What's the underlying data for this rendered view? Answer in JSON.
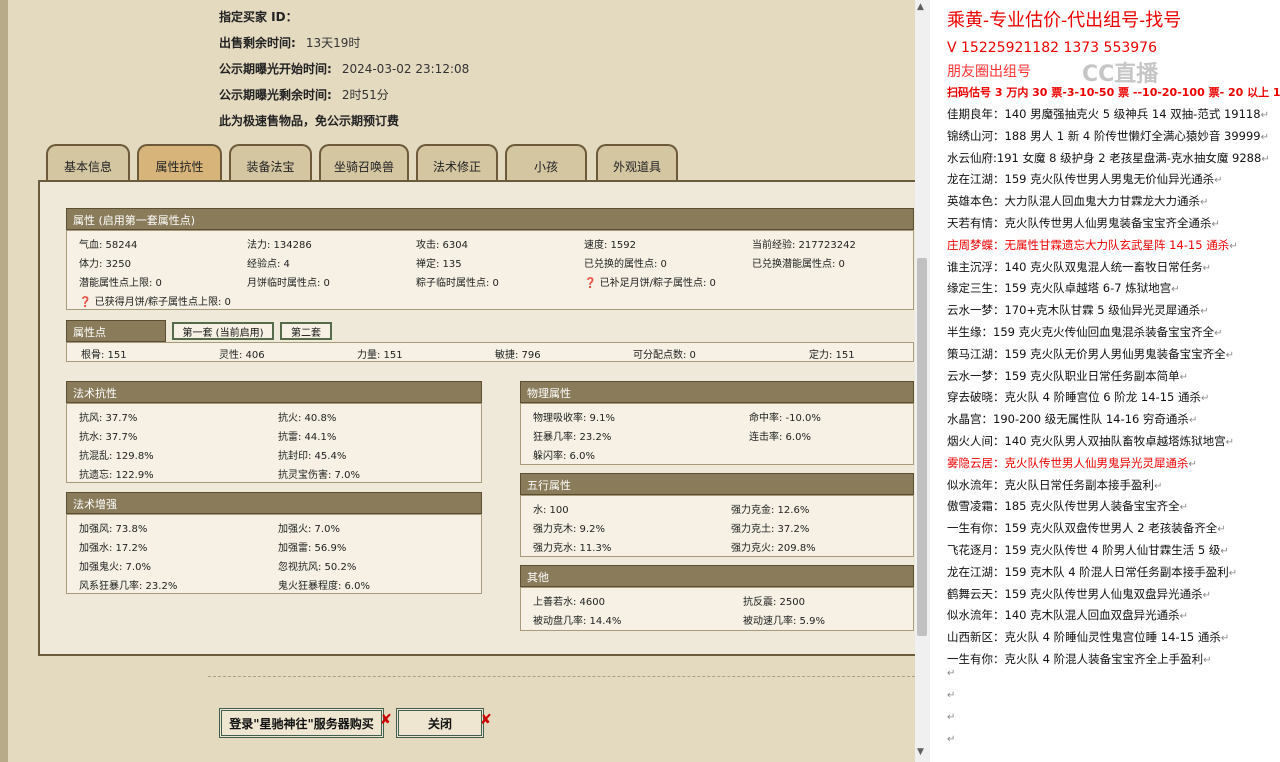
{
  "header_info": {
    "buyer_label": "指定买家 ID：",
    "remaining_label": "出售剩余时间:",
    "remaining_value": "13天19时",
    "expose_start_label": "公示期曝光开始时间:",
    "expose_start_value": "2024-03-02 23:12:08",
    "expose_remain_label": "公示期曝光剩余时间:",
    "expose_remain_value": "2时51分",
    "note": "此为极速售物品，免公示期预订费"
  },
  "tabs": [
    "基本信息",
    "属性抗性",
    "装备法宝",
    "坐骑召唤兽",
    "法术修正",
    "小孩",
    "外观道具"
  ],
  "attr_section": {
    "title": "属性 (启用第一套属性点)",
    "rows": [
      [
        "气血: 58244",
        "法力: 134286",
        "攻击: 6304",
        "速度: 1592",
        "当前经验: 217723242"
      ],
      [
        "体力: 3250",
        "经验点: 4",
        "禅定: 135",
        "已兑换的属性点: 0",
        "已兑换潜能属性点: 0"
      ],
      [
        "潜能属性点上限: 0",
        "月饼临时属性点: 0",
        "粽子临时属性点: 0",
        "已补足月饼/粽子属性点: 0",
        ""
      ]
    ],
    "last_row": "已获得月饼/粽子属性点上限: 0"
  },
  "points_section": {
    "title": "属性点",
    "subtab1": "第一套 (当前启用)",
    "subtab2": "第二套",
    "values": [
      "根骨: 151",
      "灵性: 406",
      "力量: 151",
      "敏捷: 796",
      "可分配点数: 0",
      "定力: 151"
    ]
  },
  "resist_section": {
    "title": "法术抗性",
    "items": [
      "抗风: 37.7%",
      "抗火: 40.8%",
      "抗水: 37.7%",
      "抗雷: 44.1%",
      "抗混乱: 129.8%",
      "抗封印: 45.4%",
      "抗遗忘: 122.9%",
      "抗灵宝伤害: 7.0%"
    ]
  },
  "enhance_section": {
    "title": "法术增强",
    "items": [
      "加强风: 73.8%",
      "加强火: 7.0%",
      "加强水: 17.2%",
      "加强雷: 56.9%",
      "加强鬼火: 7.0%",
      "忽视抗风: 50.2%",
      "风系狂暴几率: 23.2%",
      "鬼火狂暴程度: 6.0%"
    ]
  },
  "physical_section": {
    "title": "物理属性",
    "items": [
      "物理吸收率: 9.1%",
      "命中率: -10.0%",
      "狂暴几率: 23.2%",
      "连击率: 6.0%",
      "躲闪率: 6.0%"
    ]
  },
  "elements_section": {
    "title": "五行属性",
    "items": [
      "水: 100",
      "强力克金: 12.6%",
      "强力克木: 9.2%",
      "强力克土: 37.2%",
      "强力克水: 11.3%",
      "强力克火: 209.8%"
    ]
  },
  "other_section": {
    "title": "其他",
    "items": [
      "上善若水: 4600",
      "抗反震: 2500",
      "被动盘几率: 14.4%",
      "被动速几率: 5.9%"
    ]
  },
  "buttons": {
    "login_buy": "登录\"星驰神往\"服务器购买",
    "close": "关闭"
  },
  "right_panel": {
    "title": "乘黄-专业估价-代出组号-找号",
    "phone": "V 15225921182    1373 553976",
    "friends": "朋友圈出组号",
    "scan_line": "扫码估号 3 万内 30 票-3-10-50 票 --10-20-100 票- 20 以上 150",
    "watermark": "CC直播",
    "lines": [
      {
        "text": "佳期良年：140 男魔强抽克火 5 级神兵 14 双抽-范式 19118",
        "red": false
      },
      {
        "text": "锦绣山河：188 男人 1 新 4 阶传世懒灯全满心猿妙音 39999",
        "red": false
      },
      {
        "text": "水云仙府:191 女魔 8 级护身 2 老孩星盘满-克水抽女魔 9288",
        "red": false
      },
      {
        "text": "龙在江湖：159 克火队传世男人男鬼无价仙异光通杀",
        "red": false
      },
      {
        "text": "英雄本色：大力队混人回血鬼大力甘霖龙大力通杀",
        "red": false
      },
      {
        "text": "天若有情：克火队传世男人仙男鬼装备宝宝齐全通杀",
        "red": false
      },
      {
        "text": "庄周梦蝶：无属性甘霖遗忘大力队玄武星阵 14-15 通杀",
        "red": true
      },
      {
        "text": "谁主沉浮：140 克火队双鬼混人统一畜牧日常任务",
        "red": false
      },
      {
        "text": "缘定三生：159 克火队卓越塔 6-7 炼狱地宫",
        "red": false
      },
      {
        "text": "云水一梦：170+克木队甘霖 5 级仙异光灵犀通杀",
        "red": false
      },
      {
        "text": "半生缘：159 克火克火传仙回血鬼混杀装备宝宝齐全",
        "red": false
      },
      {
        "text": "策马江湖：159 克火队无价男人男仙男鬼装备宝宝齐全",
        "red": false
      },
      {
        "text": "云水一梦：159 克火队职业日常任务副本简单",
        "red": false
      },
      {
        "text": "穿去破晓：克火队 4 阶睡宫位 6 阶龙 14-15 通杀",
        "red": false
      },
      {
        "text": "水晶宫：190-200 级无属性队 14-16 穷奇通杀",
        "red": false
      },
      {
        "text": "烟火人间：140 克火队男人双抽队畜牧卓越塔炼狱地宫",
        "red": false
      },
      {
        "text": "雾隐云居：克火队传世男人仙男鬼异光灵犀通杀",
        "red": true
      },
      {
        "text": "似水流年：克火队日常任务副本接手盈利",
        "red": false
      },
      {
        "text": "傲雪凌霜：185 克火队传世男人装备宝宝齐全",
        "red": false
      },
      {
        "text": "一生有你：159 克火队双盘传世男人 2 老孩装备齐全",
        "red": false
      },
      {
        "text": "飞花逐月：159 克火队传世 4 阶男人仙甘霖生活 5 级",
        "red": false
      },
      {
        "text": "龙在江湖：159 克木队 4 阶混人日常任务副本接手盈利",
        "red": false
      },
      {
        "text": "鹤舞云天：159 克火队传世男人仙鬼双盘异光通杀",
        "red": false
      },
      {
        "text": "似水流年：140 克木队混人回血双盘异光通杀",
        "red": false
      },
      {
        "text": "山西新区：克火队 4 阶睡仙灵性鬼宫位睡 14-15 通杀",
        "red": false
      },
      {
        "text": "一生有你：克火队 4 阶混人装备宝宝齐全上手盈利",
        "red": false
      }
    ]
  }
}
